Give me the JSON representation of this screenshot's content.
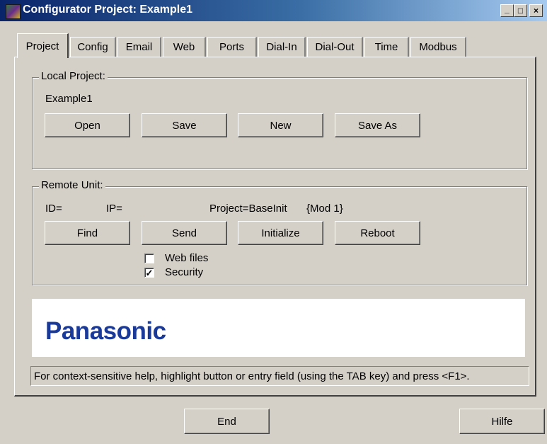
{
  "window": {
    "title": "Configurator Project: Example1",
    "controls": {
      "minimize": "_",
      "maximize": "□",
      "close": "×"
    }
  },
  "tabs": [
    {
      "label": "Project",
      "active": true
    },
    {
      "label": "Config"
    },
    {
      "label": "Email"
    },
    {
      "label": "Web"
    },
    {
      "label": "Ports"
    },
    {
      "label": "Dial-In"
    },
    {
      "label": "Dial-Out"
    },
    {
      "label": "Time"
    },
    {
      "label": "Modbus"
    }
  ],
  "local_project": {
    "legend": "Local Project:",
    "project_name": "Example1",
    "buttons": {
      "open": "Open",
      "save": "Save",
      "new": "New",
      "save_as": "Save As"
    }
  },
  "remote_unit": {
    "legend": "Remote Unit:",
    "id_label": "ID=",
    "ip_label": "IP=",
    "project_label": "Project=BaseInit",
    "module_label": "{Mod 1}",
    "buttons": {
      "find": "Find",
      "send": "Send",
      "initialize": "Initialize",
      "reboot": "Reboot"
    },
    "checkboxes": {
      "web_files": {
        "label": "Web files",
        "checked": false
      },
      "security": {
        "label": "Security",
        "checked": true
      }
    }
  },
  "logo": {
    "text": "Panasonic",
    "color": "#1a3a9a"
  },
  "help_text": "For context-sensitive help, highlight button or entry field (using the TAB key) and press <F1>.",
  "footer": {
    "end": "End",
    "help": "Hilfe"
  },
  "colors": {
    "face": "#d4d0c8",
    "title_start": "#0a246a",
    "title_end": "#a6caf0"
  }
}
